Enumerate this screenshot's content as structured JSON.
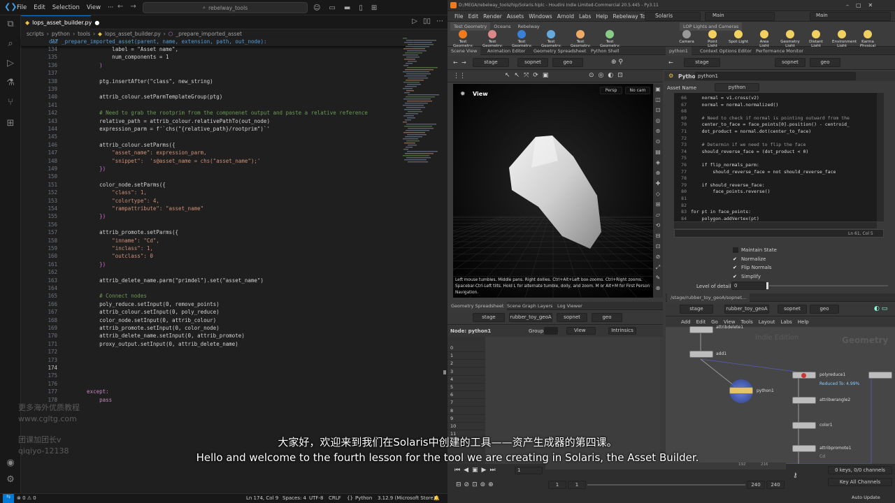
{
  "vscode": {
    "menu": [
      "File",
      "Edit",
      "Selection",
      "View",
      "···"
    ],
    "search": "rebelway_tools",
    "tab": {
      "name": "lops_asset_builder.py",
      "modified": "●"
    },
    "breadcrumb": [
      "scripts",
      "python",
      "tools",
      "lops_asset_builder.py",
      "_prepare_imported_asset"
    ],
    "sticky": {
      "num": "72",
      "code": "def _prepare_imported_asset(parent, name, extension, path, out_node):"
    },
    "lines": [
      {
        "n": "134",
        "c": "            label = \"Asset name\","
      },
      {
        "n": "135",
        "c": "            num_components = 1"
      },
      {
        "n": "136",
        "c": "        )"
      },
      {
        "n": "137",
        "c": ""
      },
      {
        "n": "138",
        "c": "        ptg.insertAfter(\"class\", new_string)"
      },
      {
        "n": "139",
        "c": ""
      },
      {
        "n": "140",
        "c": "        attrib_colour.setParmTemplateGroup(ptg)"
      },
      {
        "n": "141",
        "c": ""
      },
      {
        "n": "142",
        "c": "        # Need to grab the rootprim from the componenet output and paste a relative reference"
      },
      {
        "n": "143",
        "c": "        relative_path = attrib_colour.relativePathTo(out_node)"
      },
      {
        "n": "144",
        "c": "        expression_parm = f'`chs(\"{relative_path}/rootprim\")`'"
      },
      {
        "n": "145",
        "c": ""
      },
      {
        "n": "146",
        "c": "        attrib_colour.setParms({"
      },
      {
        "n": "147",
        "c": "            \"asset_name\": expression_parm,"
      },
      {
        "n": "148",
        "c": "            \"snippet\":  's@asset_name = chs(\"asset_name\");'"
      },
      {
        "n": "149",
        "c": "        })"
      },
      {
        "n": "150",
        "c": ""
      },
      {
        "n": "151",
        "c": "        color_node.setParms({"
      },
      {
        "n": "152",
        "c": "            \"class\": 1,"
      },
      {
        "n": "153",
        "c": "            \"colortype\": 4,"
      },
      {
        "n": "154",
        "c": "            \"rampattribute\": \"asset_name\""
      },
      {
        "n": "155",
        "c": "        })"
      },
      {
        "n": "156",
        "c": ""
      },
      {
        "n": "157",
        "c": "        attrib_promote.setParms({"
      },
      {
        "n": "158",
        "c": "            \"inname\": \"Cd\","
      },
      {
        "n": "159",
        "c": "            \"inclass\": 1,"
      },
      {
        "n": "160",
        "c": "            \"outclass\": 0"
      },
      {
        "n": "161",
        "c": "        })"
      },
      {
        "n": "162",
        "c": ""
      },
      {
        "n": "163",
        "c": "        attrib_delete_name.parm(\"primdel\").set(\"asset_name\")"
      },
      {
        "n": "164",
        "c": ""
      },
      {
        "n": "165",
        "c": "        # Connect nodes"
      },
      {
        "n": "166",
        "c": "        poly_reduce.setInput(0, remove_points)"
      },
      {
        "n": "167",
        "c": "        attrib_colour.setInput(0, poly_reduce)"
      },
      {
        "n": "168",
        "c": "        color_node.setInput(0, attrib_colour)"
      },
      {
        "n": "169",
        "c": "        attrib_promote.setInput(0, color_node)"
      },
      {
        "n": "170",
        "c": "        attrib_delete_name.setInput(0, attrib_promote)"
      },
      {
        "n": "171",
        "c": "        proxy_output.setInput(0, attrib_delete_name)"
      },
      {
        "n": "172",
        "c": ""
      },
      {
        "n": "173",
        "c": ""
      },
      {
        "n": "174",
        "c": ""
      },
      {
        "n": "175",
        "c": ""
      },
      {
        "n": "176",
        "c": ""
      },
      {
        "n": "177",
        "c": "    except:"
      },
      {
        "n": "178",
        "c": "        pass"
      }
    ],
    "status": {
      "errors": "⊗ 0 ⚠ 0",
      "pos": "Ln 174, Col 9",
      "spaces": "Spaces: 4",
      "enc": "UTF-8",
      "eol": "CRLF",
      "lang": "Python",
      "interp": "3.12.9 (Microsoft Store)"
    },
    "watermark": [
      "更多海外优质教程",
      "www.cgltg.com",
      "团课加团长v",
      "qiqiyo-12138"
    ]
  },
  "houdini": {
    "title": "D:/MEGA/rebelway_tools/hip/Solaris.hiplc - Houdini Indie Limited-Commercial 20.5.445 - Py3.11",
    "menu": [
      "File",
      "Edit",
      "Render",
      "Assets",
      "Windows",
      "Arnold",
      "Labs",
      "Help",
      "Rebelway Tools"
    ],
    "desktop": "Solaris",
    "main": "Main",
    "shelf_tabs_left": [
      "Test Geometry",
      "Oceans",
      "Rebelway"
    ],
    "shelf_tabs_right": [
      "LOP Lights and Cameras"
    ],
    "shelf_tools_left": [
      "Test Geometry: C...",
      "Test Geometry: R...",
      "Test Geometry: R...",
      "Test Geometry: S...",
      "Test Geometry: T...",
      "Test Geometry: T..."
    ],
    "shelf_tools_right": [
      "Camera",
      "Point Light",
      "Spot Light",
      "Area Light",
      "Geometry Light",
      "Distant Light",
      "Environment Light",
      "Karma Physical Sky"
    ],
    "view_tabs": [
      "Scene View",
      "Animation Editor",
      "Geometry Spreadsheet",
      "Python Shell"
    ],
    "path": [
      "stage",
      "sopnet",
      "geo"
    ],
    "viewport": {
      "label": "View",
      "persp": "Persp",
      "cam": "No cam",
      "help": "Left mouse tumbles. Middle pans. Right dollies. Ctrl+Alt+Left box-zooms. Ctrl+Right zooms. Spacebar-Ctrl-Left tilts. Hold L for alternate tumble, dolly, and zoom. M or Alt+M for First Person Navigation."
    },
    "param_tabs": [
      "python1",
      "Context Options Editor",
      "Performance Monitor"
    ],
    "param": {
      "type": "Python",
      "name": "python1",
      "asset_label": "Asset Name",
      "asset_value": "python",
      "lncol": "Ln 61, Col 5",
      "level_label": "Level of detail",
      "level_value": "0"
    },
    "python_lines": [
      {
        "n": "66",
        "c": "    normal = v1.cross(v2)"
      },
      {
        "n": "67",
        "c": "    normal = normal.normalized()"
      },
      {
        "n": "68",
        "c": ""
      },
      {
        "n": "69",
        "c": "    # Need to check if normal is pointing outward from the"
      },
      {
        "n": "70",
        "c": "    center_to_face = face_points[0].position() - centroid_"
      },
      {
        "n": "71",
        "c": "    dot_product = normal.dot(center_to_face)"
      },
      {
        "n": "72",
        "c": ""
      },
      {
        "n": "73",
        "c": "    # Determin if we need to flip the face"
      },
      {
        "n": "74",
        "c": "    should_reverse_face = (dot_product < 0)"
      },
      {
        "n": "75",
        "c": ""
      },
      {
        "n": "76",
        "c": "    if flip_normals_parm:"
      },
      {
        "n": "77",
        "c": "        should_reverse_face = not should_reverse_face"
      },
      {
        "n": "78",
        "c": ""
      },
      {
        "n": "79",
        "c": "    if should_reverse_face:"
      },
      {
        "n": "80",
        "c": "        face_points.reverse()"
      },
      {
        "n": "81",
        "c": ""
      },
      {
        "n": "82",
        "c": ""
      },
      {
        "n": "83",
        "c": "for pt in face_points:"
      },
      {
        "n": "84",
        "c": "    polygon.addVertex(pt)"
      }
    ],
    "checks": [
      {
        "label": "Maintain State",
        "on": false
      },
      {
        "label": "Normalize",
        "on": true
      },
      {
        "label": "Flip Normals",
        "on": true
      },
      {
        "label": "Simplify",
        "on": true
      }
    ],
    "sheet_tabs": [
      "Geometry Spreadsheet",
      "Scene Graph Layers",
      "Log Viewer"
    ],
    "sheet": {
      "node": "Node: python1",
      "group": "Group:",
      "view": "View",
      "intr": "Intrinsics",
      "rows": [
        "0",
        "1",
        "2",
        "3",
        "4",
        "5",
        "6",
        "7",
        "8",
        "9",
        "10",
        "11"
      ]
    },
    "net_path": "/stage/rubber_toy_geoA/sopnet...",
    "net_path_items": [
      "stage",
      "rubber_toy_geoA",
      "sopnet",
      "geo"
    ],
    "net_menu": [
      "Add",
      "Edit",
      "Go",
      "View",
      "Tools",
      "Layout",
      "Labs",
      "Help"
    ],
    "net_watermark": [
      "Indie Edition",
      "Geometry"
    ],
    "nodes": {
      "top": "attribdelete1",
      "add": "add1",
      "python": "python1",
      "polyreduce": "polyreduce1",
      "reduced": "Reduced To: 4.99%",
      "wrangle": "attribwrangle2",
      "color": "color1",
      "promote": "attribpromote1",
      "cd": "Cd"
    },
    "timeline": {
      "frame": "1",
      "start": "1",
      "end1": "240",
      "end2": "240",
      "keys": "0 keys, 0/0 channels",
      "keyall": "Key All Channels",
      "autoupdate": "Auto Update",
      "t1": "192",
      "t2": "216"
    }
  },
  "subtitles": {
    "cn": "大家好，欢迎来到我们在Solaris中创建的工具——资产生成器的第四课。",
    "en": "Hello and welcome to the fourth lesson for the tool we are creating in Solaris, the Asset Builder."
  }
}
